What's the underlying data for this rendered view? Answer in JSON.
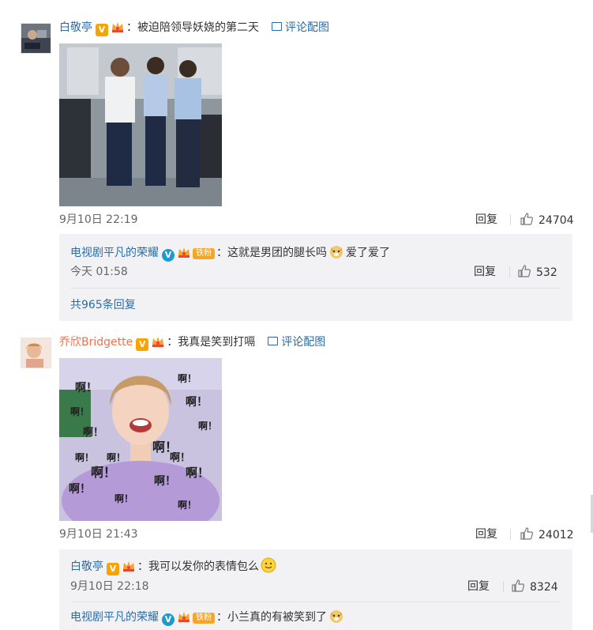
{
  "comments": [
    {
      "user": "白敬亭",
      "text": "：被迫陪领导妖娆的第二天",
      "pic_link": "评论配图",
      "time": "9月10日 22:19",
      "reply_label": "回复",
      "likes": "24704",
      "replies": [
        {
          "user": "电视剧平凡的荣耀",
          "fan_badge": "铁粉",
          "text": "：这就是男团的腿长吗",
          "text_after": "爱了爱了",
          "time": "今天 01:58",
          "reply_label": "回复",
          "likes": "532"
        }
      ],
      "more_replies": "共965条回复"
    },
    {
      "user": "乔欣Bridgette",
      "text": "：我真是笑到打嗝",
      "pic_link": "评论配图",
      "time": "9月10日 21:43",
      "reply_label": "回复",
      "likes": "24012",
      "replies": [
        {
          "user": "白敬亭",
          "text": "：我可以发你的表情包么",
          "time": "9月10日 22:18",
          "reply_label": "回复",
          "likes": "8324"
        },
        {
          "user": "电视剧平凡的荣耀",
          "fan_badge": "铁粉",
          "text": "：小兰真的有被笑到了"
        }
      ]
    }
  ],
  "sticker_text": "啊！",
  "colors": {
    "link": "#2b6ca7",
    "name": "#eb7350",
    "vip": "#f7a300",
    "verified_blue": "#1d9bd1",
    "reply_bg": "#f2f2f5"
  }
}
